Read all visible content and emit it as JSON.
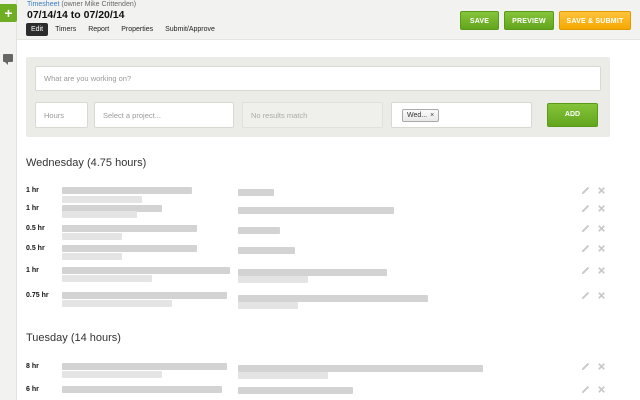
{
  "header": {
    "breadcrumb_link": "Timesheet",
    "breadcrumb_owner": "(owner Mike Crittenden)",
    "date_range": "07/14/14 to 07/20/14",
    "tabs": [
      {
        "label": "Edit",
        "active": true
      },
      {
        "label": "Timers",
        "active": false
      },
      {
        "label": "Report",
        "active": false
      },
      {
        "label": "Properties",
        "active": false
      },
      {
        "label": "Submit/Approve",
        "active": false
      }
    ],
    "buttons": {
      "save": "SAVE",
      "preview": "PREVIEW",
      "save_submit": "SAVE & SUBMIT"
    }
  },
  "form": {
    "task_placeholder": "What are you working on?",
    "hours_placeholder": "Hours",
    "project_placeholder": "Select a project...",
    "no_results": "No results match",
    "day_tag": "Wed...",
    "day_tag_remove": "×",
    "add_label": "ADD"
  },
  "days": [
    {
      "title": "Wednesday (4.75 hours)",
      "entries": [
        {
          "hours": "1 hr"
        },
        {
          "hours": "1 hr"
        },
        {
          "hours": "0.5 hr"
        },
        {
          "hours": "0.5 hr"
        },
        {
          "hours": "1 hr"
        },
        {
          "hours": "0.75 hr"
        }
      ]
    },
    {
      "title": "Tuesday (14 hours)",
      "entries": [
        {
          "hours": "8 hr"
        },
        {
          "hours": "6 hr"
        }
      ]
    }
  ],
  "colors": {
    "accent_green": "#6fae22",
    "accent_orange": "#f6a800",
    "header_bg": "#f2f2f0"
  }
}
